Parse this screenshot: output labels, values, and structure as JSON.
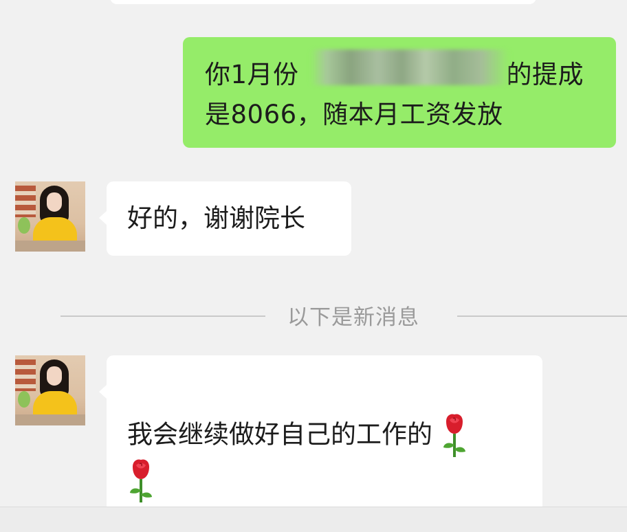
{
  "chat": {
    "sent_message": {
      "line1_start": "你1月份",
      "line1_end": "的提成",
      "line2": "是8066，随本月工资发放"
    },
    "reply_1": "好的，谢谢院长",
    "divider_label": "以下是新消息",
    "reply_2": "我会继续做好自己的工作的",
    "emoji": "rose-emoji"
  },
  "colors": {
    "sent_bubble": "#95ec69",
    "received_bubble": "#ffffff",
    "background": "#f1f1f1",
    "divider_text": "#9a9a9a"
  }
}
